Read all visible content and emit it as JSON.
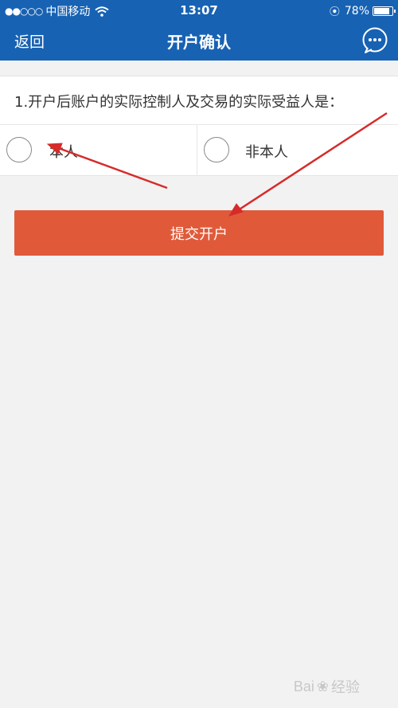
{
  "status_bar": {
    "signal": "●●○○○",
    "carrier": "中国移动",
    "time": "13:07",
    "battery": "78%",
    "battery_level": 0.78
  },
  "nav": {
    "back_label": "返回",
    "title": "开户确认",
    "chat_icon": "chat-bubble-icon"
  },
  "question": {
    "text": "1.开户后账户的实际控制人及交易的实际受益人是：",
    "options": [
      {
        "label": "本人"
      },
      {
        "label": "非本人"
      }
    ]
  },
  "submit_label": "提交开户",
  "colors": {
    "nav_bg": "#1762b3",
    "submit_bg": "#e05a3a",
    "annotation_arrow": "#d62b2b"
  },
  "watermark": {
    "text_left": "Bai",
    "text_right": "经验"
  }
}
